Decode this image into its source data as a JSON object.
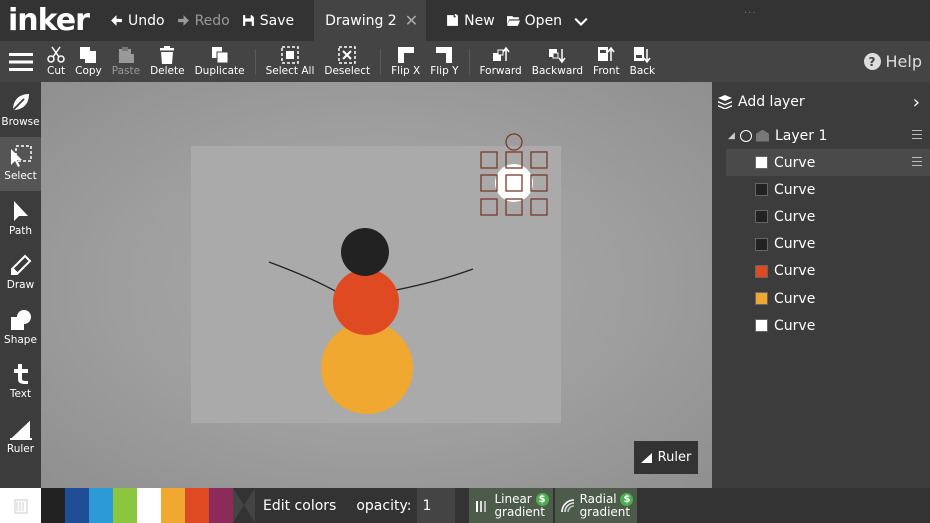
{
  "app": {
    "logo": "inker"
  },
  "topbar": {
    "undo": "Undo",
    "redo": "Redo",
    "save": "Save",
    "doc_tab": "Drawing 2",
    "new": "New",
    "open": "Open"
  },
  "toolbar": {
    "cut": "Cut",
    "copy": "Copy",
    "paste": "Paste",
    "delete": "Delete",
    "duplicate": "Duplicate",
    "select_all": "Select All",
    "deselect": "Deselect",
    "flip_x": "Flip X",
    "flip_y": "Flip Y",
    "forward": "Forward",
    "backward": "Backward",
    "front": "Front",
    "back": "Back",
    "help": "Help"
  },
  "tools": [
    {
      "label": "Browse",
      "icon": "leaf-icon"
    },
    {
      "label": "Select",
      "icon": "select-cursor-icon",
      "active": true
    },
    {
      "label": "Path",
      "icon": "arrow-cursor-icon"
    },
    {
      "label": "Draw",
      "icon": "pencil-icon"
    },
    {
      "label": "Shape",
      "icon": "shape-icon"
    },
    {
      "label": "Text",
      "icon": "text-t-icon"
    },
    {
      "label": "Ruler",
      "icon": "ruler-icon"
    }
  ],
  "canvas": {
    "ruler_label": "Ruler"
  },
  "layers_panel": {
    "add_layer": "Add layer",
    "layer_name": "Layer 1",
    "items": [
      {
        "label": "Curve",
        "color": "#ffffff",
        "selected": true
      },
      {
        "label": "Curve",
        "color": "#222222"
      },
      {
        "label": "Curve",
        "color": "#222222"
      },
      {
        "label": "Curve",
        "color": "#222222"
      },
      {
        "label": "Curve",
        "color": "#e04a22"
      },
      {
        "label": "Curve",
        "color": "#f0a830"
      },
      {
        "label": "Curve",
        "color": "#ffffff"
      }
    ]
  },
  "bottombar": {
    "palette": [
      "#222222",
      "#1f4e96",
      "#2d9ad8",
      "#8cc63f",
      "#ffffff",
      "#f0a830",
      "#e04a22",
      "#8b2b5a"
    ],
    "edit_colors": "Edit colors",
    "opacity_label": "opacity:",
    "opacity_value": "1",
    "linear_gradient_1": "Linear",
    "linear_gradient_2": "gradient",
    "radial_gradient_1": "Radial",
    "radial_gradient_2": "gradient",
    "pro_badge": "$"
  }
}
